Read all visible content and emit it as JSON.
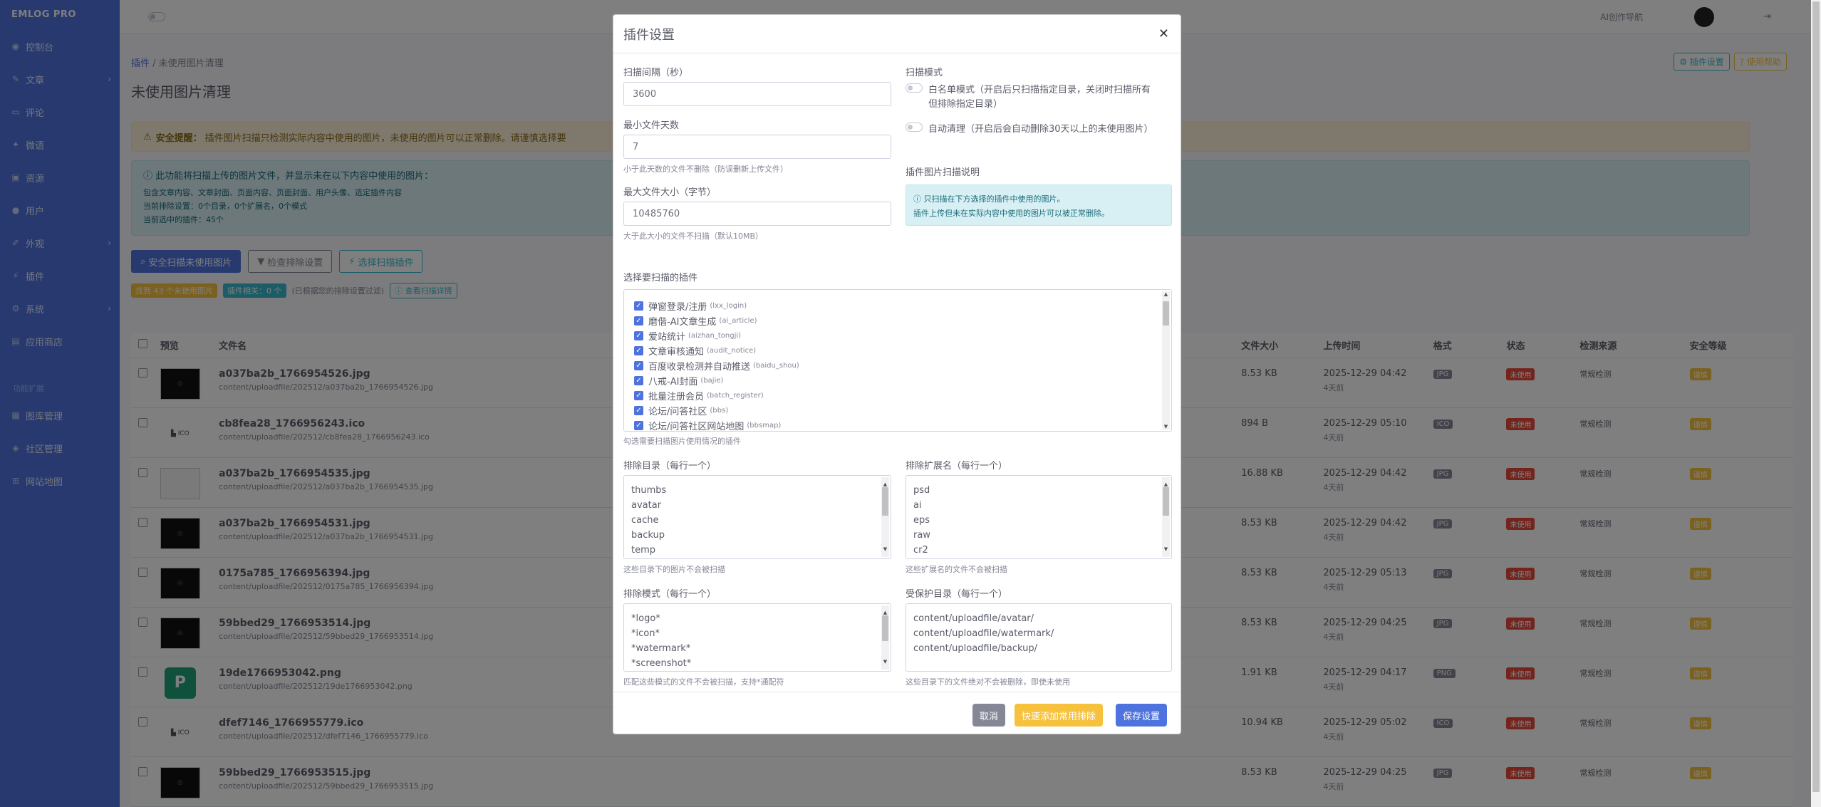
{
  "sidebar": {
    "brand": "EMLOG PRO",
    "items": [
      {
        "label": "控制台",
        "icon": "dashboard-icon",
        "chevron": false
      },
      {
        "label": "文章",
        "icon": "edit-icon",
        "chevron": true
      },
      {
        "label": "评论",
        "icon": "comment-icon",
        "chevron": false
      },
      {
        "label": "微语",
        "icon": "note-icon",
        "chevron": false
      },
      {
        "label": "资源",
        "icon": "folder-icon",
        "chevron": false
      },
      {
        "label": "用户",
        "icon": "user-icon",
        "chevron": false
      },
      {
        "label": "外观",
        "icon": "brush-icon",
        "chevron": true
      },
      {
        "label": "插件",
        "icon": "plug-icon",
        "chevron": false
      },
      {
        "label": "系统",
        "icon": "gear-icon",
        "chevron": true
      },
      {
        "label": "应用商店",
        "icon": "store-icon",
        "chevron": false
      }
    ],
    "section_heading": "功能扩展",
    "extra_items": [
      {
        "label": "图库管理",
        "icon": "image-icon"
      },
      {
        "label": "社区管理",
        "icon": "community-icon"
      },
      {
        "label": "网站地图",
        "icon": "sitemap-icon"
      }
    ]
  },
  "topbar": {
    "ai_label": "AI创作导航"
  },
  "page": {
    "breadcrumb_root": "插件",
    "breadcrumb_current": "未使用图片清理",
    "title": "未使用图片清理",
    "btn_settings": "插件设置",
    "btn_help": "使用帮助",
    "warning_title": "安全提醒：",
    "warning_text": "插件图片扫描只检测实际内容中使用的图片，未使用的图片可以正常删除。请谨慎选择要",
    "info_title": "此功能将扫描上传的图片文件，并显示未在以下内容中使用的图片：",
    "info_lines": [
      "包含文章内容、文章封面、页面内容、页面封面、用户头像、选定插件内容",
      "当前排除设置：0个目录，0个扩展名，0个模式",
      "当前选中的插件：45个"
    ],
    "btn_scan": "安全扫描未使用图片",
    "btn_check": "检查排除设置",
    "btn_select": "选择扫描插件",
    "stat_found": "找到 43 个未使用图片",
    "stat_protect": "插件相关：0 个",
    "stat_note": "(已根据您的排除设置过滤)",
    "btn_details": "查看扫描详情"
  },
  "table": {
    "headers": [
      "",
      "预览",
      "文件名",
      "文件大小",
      "上传时间",
      "格式",
      "状态",
      "检测来源",
      "安全等级"
    ],
    "rows": [
      {
        "name": "a037ba2b_1766954526.jpg",
        "path": "content/uploadfile/202512/a037ba2b_1766954526.jpg",
        "size": "8.53 KB",
        "time": "2025-12-29 04:42",
        "ago": "4天前",
        "fmt": "JPG",
        "status": "未使用",
        "src": "常规检测",
        "level": "谨慎",
        "thumb": "dark"
      },
      {
        "name": "cb8fea28_1766956243.ico",
        "path": "content/uploadfile/202512/cb8fea28_1766956243.ico",
        "size": "894 B",
        "time": "2025-12-29 05:10",
        "ago": "4天前",
        "fmt": "ICO",
        "status": "未使用",
        "src": "常规检测",
        "level": "谨慎",
        "thumb": "ico"
      },
      {
        "name": "a037ba2b_1766954535.jpg",
        "path": "content/uploadfile/202512/a037ba2b_1766954535.jpg",
        "size": "16.88 KB",
        "time": "2025-12-29 04:42",
        "ago": "4天前",
        "fmt": "JPG",
        "status": "未使用",
        "src": "常规检测",
        "level": "谨慎",
        "thumb": "light"
      },
      {
        "name": "a037ba2b_1766954531.jpg",
        "path": "content/uploadfile/202512/a037ba2b_1766954531.jpg",
        "size": "8.53 KB",
        "time": "2025-12-29 04:42",
        "ago": "4天前",
        "fmt": "JPG",
        "status": "未使用",
        "src": "常规检测",
        "level": "谨慎",
        "thumb": "dark"
      },
      {
        "name": "0175a785_1766956394.jpg",
        "path": "content/uploadfile/202512/0175a785_1766956394.jpg",
        "size": "8.53 KB",
        "time": "2025-12-29 05:13",
        "ago": "4天前",
        "fmt": "JPG",
        "status": "未使用",
        "src": "常规检测",
        "level": "谨慎",
        "thumb": "dark"
      },
      {
        "name": "59bbed29_1766953514.jpg",
        "path": "content/uploadfile/202512/59bbed29_1766953514.jpg",
        "size": "8.53 KB",
        "time": "2025-12-29 04:25",
        "ago": "4天前",
        "fmt": "JPG",
        "status": "未使用",
        "src": "常规检测",
        "level": "谨慎",
        "thumb": "dark"
      },
      {
        "name": "19de1766953042.png",
        "path": "content/uploadfile/202512/19de1766953042.png",
        "size": "1.91 KB",
        "time": "2025-12-29 04:17",
        "ago": "4天前",
        "fmt": "PNG",
        "status": "未使用",
        "src": "常规检测",
        "level": "谨慎",
        "thumb": "png"
      },
      {
        "name": "dfef7146_1766955779.ico",
        "path": "content/uploadfile/202512/dfef7146_1766955779.ico",
        "size": "10.94 KB",
        "time": "2025-12-29 05:02",
        "ago": "4天前",
        "fmt": "ICO",
        "status": "未使用",
        "src": "常规检测",
        "level": "谨慎",
        "thumb": "ico"
      },
      {
        "name": "59bbed29_1766953515.jpg",
        "path": "content/uploadfile/202512/59bbed29_1766953515.jpg",
        "size": "8.53 KB",
        "time": "2025-12-29 04:25",
        "ago": "4天前",
        "fmt": "JPG",
        "status": "未使用",
        "src": "常规检测",
        "level": "谨慎",
        "thumb": "dark"
      }
    ]
  },
  "modal": {
    "title": "插件设置",
    "scan_interval_label": "扫描间隔（秒）",
    "scan_interval_value": "3600",
    "min_days_label": "最小文件天数",
    "min_days_value": "7",
    "min_days_hint": "小于此天数的文件不删除（防误删新上传文件）",
    "max_size_label": "最大文件大小（字节）",
    "max_size_value": "10485760",
    "max_size_hint": "大于此大小的文件不扫描（默认10MB）",
    "scan_mode_label": "扫描模式",
    "whitelist_label": "白名单模式（开启后只扫描指定目录，关闭时扫描所有",
    "whitelist_label2": "但排除指定目录）",
    "auto_clean_label": "自动清理（开启后会自动删除30天以上的未使用图片）",
    "plugin_scan_title": "插件图片扫描说明",
    "plugin_scan_info1": "只扫描在下方选择的插件中使用的图片。",
    "plugin_scan_info2": "插件上传但未在实际内容中使用的图片可以被正常删除。",
    "plugins_label": "选择要扫描的插件",
    "plugins": [
      {
        "name": "弹窗登录/注册",
        "code": "(lxx_login)"
      },
      {
        "name": "磨偕-AI文章生成",
        "code": "(ai_article)"
      },
      {
        "name": "爱站统计",
        "code": "(aizhan_tongji)"
      },
      {
        "name": "文章审核通知",
        "code": "(audit_notice)"
      },
      {
        "name": "百度收录检测并自动推送",
        "code": "(baidu_shou)"
      },
      {
        "name": "八戒-AI封面",
        "code": "(bajie)"
      },
      {
        "name": "批量注册会员",
        "code": "(batch_register)"
      },
      {
        "name": "论坛/问答社区",
        "code": "(bbs)"
      },
      {
        "name": "论坛/问答社区网站地图",
        "code": "(bbsmap)"
      }
    ],
    "plugins_hint": "勾选需要扫描图片使用情况的插件",
    "exclude_dirs_label": "排除目录（每行一个）",
    "exclude_dirs": [
      "thumbs",
      "avatar",
      "cache",
      "backup",
      "temp"
    ],
    "exclude_dirs_hint": "这些目录下的图片不会被扫描",
    "exclude_ext_label": "排除扩展名（每行一个）",
    "exclude_ext": [
      "psd",
      "ai",
      "eps",
      "raw",
      "cr2"
    ],
    "exclude_ext_hint": "这些扩展名的文件不会被扫描",
    "exclude_patterns_label": "排除模式（每行一个）",
    "exclude_patterns": [
      "*logo*",
      "*icon*",
      "*watermark*",
      "*screenshot*"
    ],
    "exclude_patterns_hint": "匹配这些模式的文件不会被扫描，支持*通配符",
    "protected_dirs_label": "受保护目录（每行一个）",
    "protected_dirs": [
      "content/uploadfile/avatar/",
      "content/uploadfile/watermark/",
      "content/uploadfile/backup/"
    ],
    "protected_dirs_hint": "这些目录下的文件绝对不会被删除，即使未使用",
    "btn_cancel": "取消",
    "btn_quick": "快速添加常用排除",
    "btn_save": "保存设置"
  },
  "colors": {
    "primary": "#4e73df",
    "sidebar": "#4e73df",
    "danger": "#e74a3b",
    "warning": "#f6c23e",
    "secondary": "#858796",
    "info": "#36b9cc",
    "success": "#1cc88a"
  }
}
